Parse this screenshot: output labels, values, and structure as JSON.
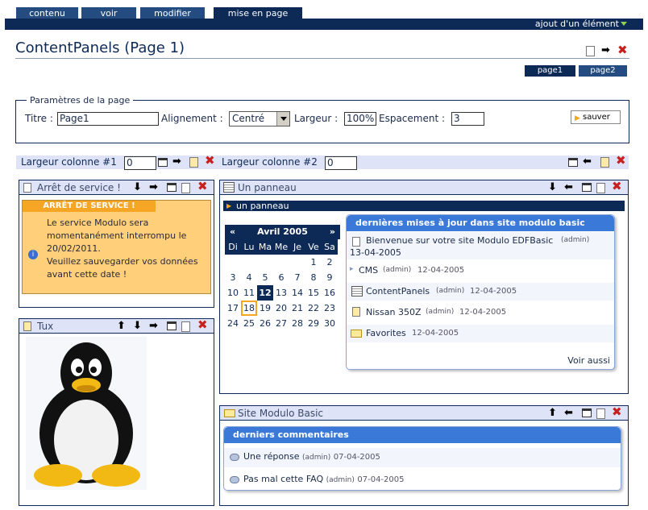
{
  "tabs": [
    "contenu",
    "voir",
    "modifier",
    "mise en page"
  ],
  "topbar": {
    "add_element": "ajout d'un élément"
  },
  "page": {
    "title": "ContentPanels (Page 1)",
    "pages": [
      "page1",
      "page2"
    ]
  },
  "settings": {
    "legend": "Paramètres de la page",
    "title_label": "Titre :",
    "title_value": "Page1",
    "align_label": "Alignement :",
    "align_value": "Centré",
    "width_label": "Largeur :",
    "width_value": "100%",
    "spacing_label": "Espacement :",
    "spacing_value": "3",
    "save_label": "sauver"
  },
  "columns": {
    "col1_label": "Largeur colonne #1",
    "col1_value": "0",
    "col2_label": "Largeur colonne #2",
    "col2_value": "0"
  },
  "panel_service": {
    "title": "Arrêt de service !",
    "header": "ARRÊT DE SERVICE !",
    "lines": [
      "Le service Modulo sera",
      "momentanément interrompu le",
      "20/02/2011.",
      "Veuillez sauvegarder vos données",
      "avant cette date !"
    ]
  },
  "panel_tux": {
    "title": "Tux"
  },
  "panel_un": {
    "title": "Un panneau",
    "subheader": "un panneau",
    "calendar": {
      "prev": "«",
      "month": "Avril 2005",
      "next": "»",
      "days": [
        "Di",
        "Lu",
        "Ma",
        "Me",
        "Je",
        "Ve",
        "Sa"
      ],
      "weeks": [
        [
          "",
          "",
          "",
          "",
          "",
          "1",
          "2"
        ],
        [
          "3",
          "4",
          "5",
          "6",
          "7",
          "8",
          "9"
        ],
        [
          "10",
          "11",
          "12",
          "13",
          "14",
          "15",
          "16"
        ],
        [
          "17",
          "18",
          "19",
          "20",
          "21",
          "22",
          "23"
        ],
        [
          "24",
          "25",
          "26",
          "27",
          "28",
          "29",
          "30"
        ]
      ],
      "selected": "12",
      "today": "18"
    },
    "recent": {
      "title": "dernières mises à jour dans site modulo basic",
      "items": [
        {
          "name": "Bienvenue sur votre site Modulo EDFBasic",
          "author": "(admin)",
          "date": "13-04-2005"
        },
        {
          "name": "CMS",
          "author": "(admin)",
          "date": "12-04-2005"
        },
        {
          "name": "ContentPanels",
          "author": "(admin)",
          "date": "12-04-2005"
        },
        {
          "name": "Nissan 350Z",
          "author": "(admin)",
          "date": "12-04-2005"
        },
        {
          "name": "Favorites",
          "author": "",
          "date": "12-04-2005"
        }
      ],
      "more": "Voir aussi"
    }
  },
  "panel_site": {
    "title": "Site Modulo Basic",
    "box_title": "derniers commentaires",
    "comments": [
      {
        "text": "Une réponse",
        "author": "(admin)",
        "date": "07-04-2005"
      },
      {
        "text": "Pas mal cette FAQ",
        "author": "(admin)",
        "date": "07-04-2005"
      }
    ]
  },
  "colors": {
    "navy": "#0d2a57",
    "header_bg": "#dfe3f7",
    "warning_bg": "#ffcf7a",
    "warning_head": "#f7a525"
  }
}
